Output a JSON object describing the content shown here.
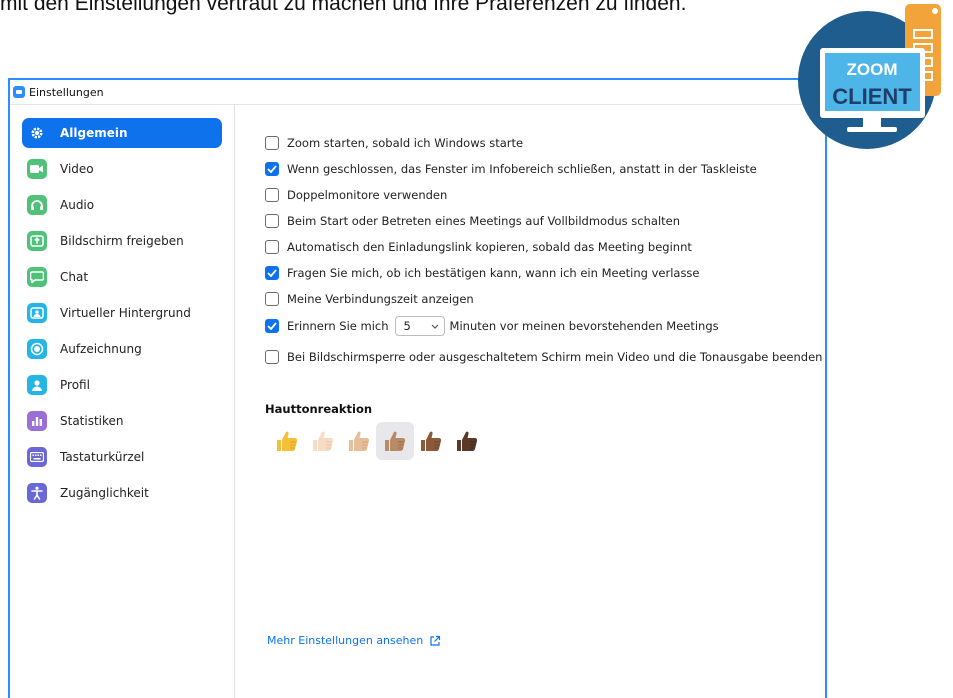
{
  "article": {
    "line": "mit den Einstellungen vertraut zu machen und Ihre Präferenzen zu finden."
  },
  "window": {
    "title": "Einstellungen"
  },
  "sidebar": {
    "items": [
      {
        "label": "Allgemein",
        "icon": "gear-icon",
        "color": "#0e72ed",
        "active": true
      },
      {
        "label": "Video",
        "icon": "video-camera-icon",
        "color": "#4fc27a"
      },
      {
        "label": "Audio",
        "icon": "headphones-icon",
        "color": "#4fc27a"
      },
      {
        "label": "Bildschirm freigeben",
        "icon": "share-screen-icon",
        "color": "#4fc27a"
      },
      {
        "label": "Chat",
        "icon": "chat-bubble-icon",
        "color": "#4fc27a"
      },
      {
        "label": "Virtueller Hintergrund",
        "icon": "virtual-background-icon",
        "color": "#24b5e6"
      },
      {
        "label": "Aufzeichnung",
        "icon": "record-icon",
        "color": "#24b5e6"
      },
      {
        "label": "Profil",
        "icon": "profile-icon",
        "color": "#24b5e6"
      },
      {
        "label": "Statistiken",
        "icon": "statistics-icon",
        "color": "#9b6fd6"
      },
      {
        "label": "Tastaturkürzel",
        "icon": "keyboard-icon",
        "color": "#6a67d6"
      },
      {
        "label": "Zugänglichkeit",
        "icon": "accessibility-icon",
        "color": "#6a67d6"
      }
    ]
  },
  "general": {
    "options": [
      {
        "label": "Zoom starten, sobald ich Windows starte",
        "checked": false
      },
      {
        "label": "Wenn geschlossen, das Fenster im Infobereich schließen, anstatt in der Taskleiste",
        "checked": true
      },
      {
        "label": "Doppelmonitore verwenden",
        "checked": false
      },
      {
        "label": "Beim Start oder Betreten eines Meetings auf Vollbildmodus schalten",
        "checked": false
      },
      {
        "label": "Automatisch den Einladungslink kopieren, sobald das Meeting beginnt",
        "checked": false
      },
      {
        "label": "Fragen Sie mich, ob ich bestätigen kann, wann ich ein Meeting verlasse",
        "checked": true
      },
      {
        "label": "Meine Verbindungszeit anzeigen",
        "checked": false
      }
    ],
    "remind": {
      "label_before": "Erinnern Sie mich",
      "minutes": "5",
      "label_after": "Minuten vor meinen bevorstehenden Meetings",
      "checked": true
    },
    "screenlock": {
      "label": "Bei Bildschirmsperre oder ausgeschaltetem Schirm mein Video und die Tonausgabe beenden",
      "checked": false
    },
    "skin_tone": {
      "title": "Hauttonreaktion",
      "tones": [
        "#f5c038",
        "#f7dcc4",
        "#e5bf9c",
        "#b98a66",
        "#8a5a3b",
        "#5a3a26"
      ],
      "selected_index": 3
    },
    "more_link": "Mehr Einstellungen ansehen"
  },
  "badge": {
    "line1": "ZOOM",
    "line2": "CLIENT",
    "bg": "#1f5d8e",
    "accent": "#f2a33a"
  }
}
